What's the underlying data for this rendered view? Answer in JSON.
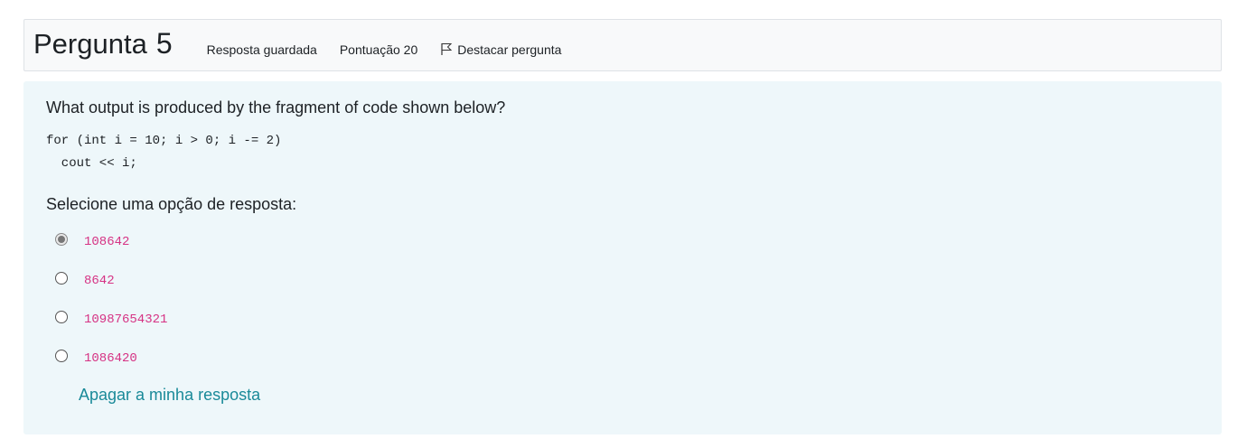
{
  "question": {
    "title_word": "Pergunta",
    "number": "5",
    "status": "Resposta guardada",
    "score": "Pontuação 20",
    "flag_label": "Destacar pergunta",
    "flag_icon": "flag-outline-icon",
    "text": "What output is produced by the fragment of code shown below?",
    "code": "for (int i = 10; i > 0; i -= 2)\n  cout << i;",
    "prompt": "Selecione uma opção de resposta:",
    "options": [
      {
        "label": "108642",
        "selected": true
      },
      {
        "label": "8642",
        "selected": false
      },
      {
        "label": "10987654321",
        "selected": false
      },
      {
        "label": "1086420",
        "selected": false
      }
    ],
    "clear_label": "Apagar a minha resposta"
  },
  "colors": {
    "content_bg": "#eef7fa",
    "option_text": "#d63384",
    "link": "#1a8a99"
  }
}
